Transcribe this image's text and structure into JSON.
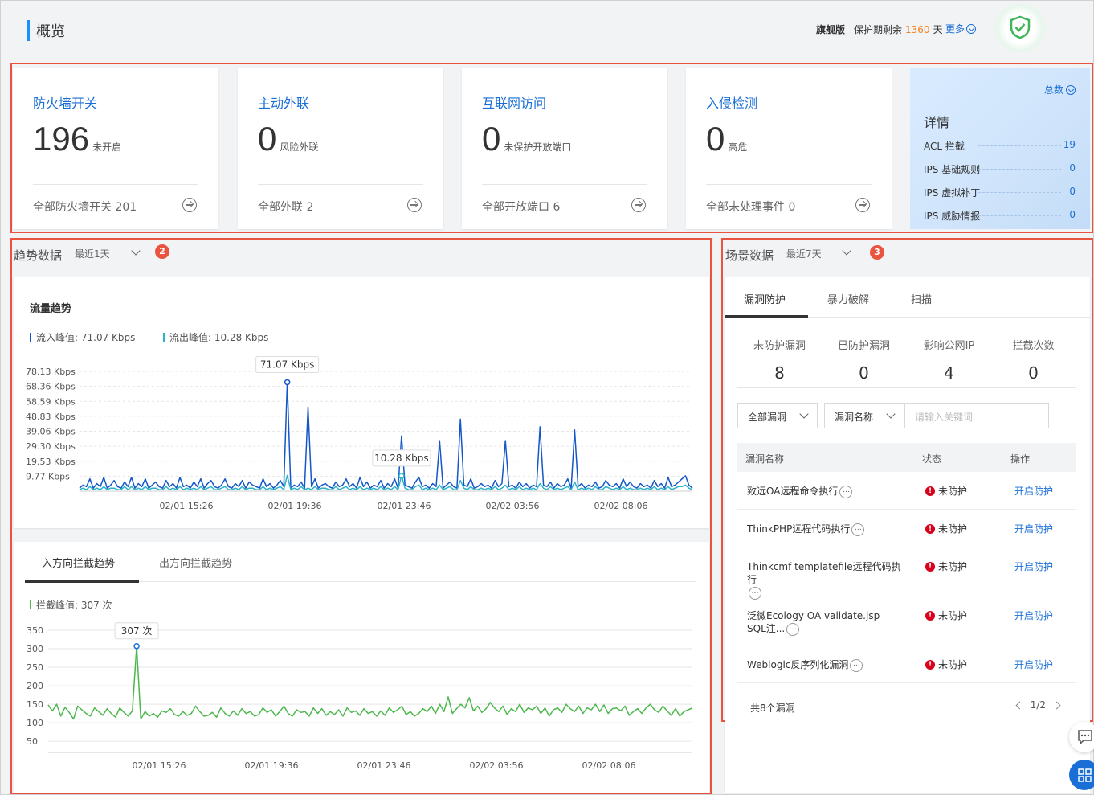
{
  "header": {
    "title": "概览",
    "edition": "旗舰版",
    "protection_prefix": "保护期剩余",
    "protection_days": "1360",
    "protection_suffix": "天",
    "more": "更多"
  },
  "badges": [
    "1",
    "2",
    "3"
  ],
  "cards": [
    {
      "title": "防火墙开关",
      "value": "196",
      "unit": "未开启",
      "footer": "全部防火墙开关 201"
    },
    {
      "title": "主动外联",
      "value": "0",
      "unit": "风险外联",
      "footer": "全部外联 2"
    },
    {
      "title": "互联网访问",
      "value": "0",
      "unit": "未保护开放端口",
      "footer": "全部开放端口 6"
    },
    {
      "title": "入侵检测",
      "value": "0",
      "unit": "高危",
      "footer": "全部未处理事件 0"
    }
  ],
  "detail": {
    "total": "总数",
    "title": "详情",
    "rows": [
      {
        "label": "ACL 拦截",
        "value": "19"
      },
      {
        "label": "IPS 基础规则",
        "value": "0"
      },
      {
        "label": "IPS 虚拟补丁",
        "value": "0"
      },
      {
        "label": "IPS 威胁情报",
        "value": "0"
      }
    ]
  },
  "trend": {
    "title": "趋势数据",
    "range": "最近1天",
    "traffic_title": "流量趋势",
    "legend_in": "流入峰值: 71.07 Kbps",
    "legend_out": "流出峰值: 10.28 Kbps",
    "tabs": [
      "入方向拦截趋势",
      "出方向拦截趋势"
    ],
    "legend_block": "拦截峰值: 307 次"
  },
  "scene": {
    "title": "场景数据",
    "range": "最近7天",
    "tabs": [
      "漏洞防护",
      "暴力破解",
      "扫描"
    ],
    "stats": [
      {
        "label": "未防护漏洞",
        "value": "8"
      },
      {
        "label": "已防护漏洞",
        "value": "0"
      },
      {
        "label": "影响公网IP",
        "value": "4"
      },
      {
        "label": "拦截次数",
        "value": "0"
      }
    ],
    "filter_all": "全部漏洞",
    "filter_field": "漏洞名称",
    "search_placeholder": "请输入关键词",
    "columns": [
      "漏洞名称",
      "状态",
      "操作"
    ],
    "rows": [
      {
        "name": "致远OA远程命令执行",
        "status": "未防护",
        "action": "开启防护"
      },
      {
        "name": "ThinkPHP远程代码执行",
        "status": "未防护",
        "action": "开启防护"
      },
      {
        "name": "Thinkcmf templatefile远程代码执行",
        "status": "未防护",
        "action": "开启防护"
      },
      {
        "name": "泛微Ecology OA validate.jsp SQL注...",
        "status": "未防护",
        "action": "开启防护"
      },
      {
        "name": "Weblogic反序列化漏洞",
        "status": "未防护",
        "action": "开启防护"
      }
    ],
    "total": "共8个漏洞",
    "page": "1/2"
  },
  "colors": {
    "accent": "#1a6fd6",
    "inflow": "#1557c9",
    "outflow": "#2bb3c9",
    "block": "#4cb84c",
    "alert": "#e9533f",
    "days": "#f5821f"
  },
  "chart_data": [
    {
      "type": "line",
      "title": "流量趋势",
      "y_tick_labels": [
        "78.13 Kbps",
        "68.36 Kbps",
        "58.59 Kbps",
        "48.83 Kbps",
        "39.06 Kbps",
        "29.30 Kbps",
        "19.53 Kbps",
        "9.77 Kbps"
      ],
      "y_ticks": [
        78.13,
        68.36,
        58.59,
        48.83,
        39.06,
        29.3,
        19.53,
        9.77
      ],
      "ylim": [
        0,
        78.13
      ],
      "x_tick_labels": [
        "02/01 15:26",
        "02/01 19:36",
        "02/01 23:46",
        "02/02 03:56",
        "02/02 08:06"
      ],
      "peak_labels": [
        "71.07 Kbps",
        "10.28 Kbps"
      ],
      "series": [
        {
          "name": "流入峰值",
          "values": [
            2,
            4,
            3,
            8,
            2,
            5,
            3,
            9,
            2,
            4,
            7,
            3,
            2,
            6,
            3,
            9,
            2,
            5,
            3,
            8,
            2,
            4,
            6,
            3,
            2,
            7,
            3,
            5,
            2,
            9,
            3,
            4,
            2,
            6,
            3,
            8,
            2,
            5,
            7,
            3,
            2,
            4,
            8,
            3,
            2,
            5,
            3,
            7,
            2,
            6,
            4,
            3,
            2,
            8,
            3,
            5,
            2,
            4,
            7,
            3,
            71.07,
            2,
            4,
            3,
            6,
            2,
            55,
            3,
            8,
            2,
            4,
            5,
            3,
            2,
            6,
            3,
            4,
            8,
            3,
            5,
            2,
            9,
            3,
            6,
            2,
            4,
            3,
            7,
            2,
            5,
            3,
            8,
            2,
            36,
            4,
            3,
            2,
            6,
            9,
            3,
            4,
            2,
            5,
            3,
            33,
            2,
            4,
            6,
            3,
            2,
            47,
            4,
            3,
            8,
            2,
            3,
            5,
            3,
            4,
            2,
            7,
            3,
            5,
            33,
            3,
            4,
            2,
            6,
            3,
            5,
            2,
            4,
            3,
            42,
            4,
            3,
            6,
            2,
            5,
            3,
            4,
            8,
            2,
            40,
            3,
            5,
            2,
            4,
            3,
            6,
            2,
            3,
            7,
            4,
            3,
            5,
            2,
            8,
            3,
            6,
            3,
            2,
            5,
            3,
            4,
            2,
            7,
            3,
            5,
            2,
            9,
            3,
            4,
            6,
            8,
            10,
            4,
            2
          ]
        },
        {
          "name": "流出峰值",
          "values": [
            1,
            2,
            1,
            3,
            1,
            2,
            1,
            3,
            1,
            2,
            2,
            1,
            1,
            3,
            1,
            3,
            1,
            2,
            1,
            3,
            1,
            2,
            2,
            1,
            1,
            3,
            1,
            2,
            1,
            3,
            1,
            2,
            1,
            2,
            1,
            3,
            1,
            2,
            3,
            1,
            1,
            2,
            3,
            1,
            1,
            2,
            1,
            3,
            1,
            2,
            2,
            1,
            1,
            3,
            1,
            2,
            1,
            2,
            3,
            1,
            10.28,
            1,
            2,
            1,
            3,
            1,
            2,
            1,
            3,
            1,
            2,
            2,
            1,
            1,
            3,
            1,
            2,
            3,
            1,
            2,
            1,
            3,
            1,
            2,
            1,
            2,
            1,
            3,
            1,
            2,
            1,
            3,
            1,
            10,
            2,
            1,
            1,
            3,
            4,
            1,
            2,
            1,
            2,
            1,
            4,
            1,
            2,
            3,
            1,
            1,
            7,
            2,
            1,
            3,
            1,
            1,
            2,
            1,
            2,
            1,
            3,
            1,
            2,
            4,
            1,
            2,
            1,
            3,
            1,
            2,
            1,
            2,
            1,
            5,
            2,
            1,
            3,
            1,
            2,
            1,
            2,
            3,
            1,
            6,
            1,
            2,
            1,
            2,
            1,
            3,
            1,
            1,
            3,
            2,
            1,
            2,
            1,
            3,
            1,
            2,
            1,
            1,
            2,
            1,
            2,
            1,
            3,
            1,
            2,
            1,
            3,
            1,
            2,
            3,
            3,
            4,
            2,
            1
          ]
        }
      ],
      "peak_index": [
        60,
        60
      ]
    },
    {
      "type": "line",
      "title": "入方向拦截趋势",
      "y_ticks": [
        350,
        300,
        250,
        200,
        150,
        100,
        50
      ],
      "ylim": [
        20,
        350
      ],
      "x_tick_labels": [
        "02/01 15:26",
        "02/01 19:36",
        "02/01 23:46",
        "02/02 03:56",
        "02/02 08:06"
      ],
      "peak_label": "307 次",
      "series": [
        {
          "name": "拦截峰值",
          "values": [
            148,
            132,
            150,
            118,
            142,
            128,
            110,
            145,
            135,
            125,
            118,
            140,
            130,
            120,
            138,
            125,
            115,
            140,
            128,
            118,
            132,
            307,
            110,
            130,
            118,
            125,
            115,
            132,
            128,
            138,
            122,
            118,
            130,
            120,
            125,
            145,
            130,
            118,
            120,
            128,
            115,
            140,
            125,
            118,
            132,
            120,
            138,
            125,
            130,
            118,
            122,
            140,
            128,
            135,
            118,
            130,
            145,
            125,
            118,
            135,
            128,
            130,
            118,
            140,
            125,
            138,
            120,
            130,
            122,
            135,
            118,
            140,
            128,
            132,
            120,
            138,
            125,
            130,
            118,
            132,
            120,
            140,
            128,
            135,
            145,
            122,
            130,
            118,
            125,
            138,
            130,
            145,
            125,
            150,
            130,
            170,
            125,
            138,
            150,
            140,
            168,
            132,
            145,
            128,
            138,
            155,
            140,
            130,
            145,
            122,
            138,
            130,
            150,
            128,
            140,
            135,
            145,
            125,
            140,
            118,
            135,
            140,
            128,
            150,
            138,
            130,
            145,
            125,
            140,
            135,
            150,
            130,
            148,
            125,
            138,
            140,
            132,
            145,
            120,
            130,
            138,
            125,
            140,
            150,
            135,
            128,
            145,
            132,
            120,
            138,
            118,
            130,
            135,
            140
          ]
        }
      ]
    }
  ]
}
